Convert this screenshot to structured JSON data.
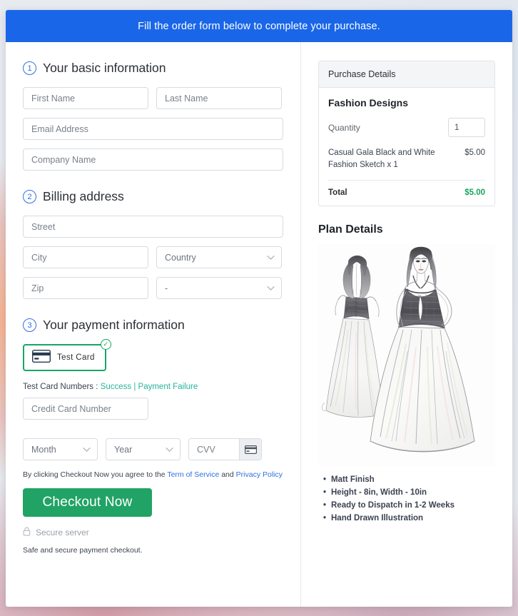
{
  "banner": {
    "message": "Fill the order form below to complete your purchase."
  },
  "colors": {
    "banner_blue": "#1a66e8",
    "accent_blue": "#2f6fe0",
    "success_green": "#16a765",
    "checkout_green": "#21a366",
    "total_green": "#17a45f",
    "link_teal": "#27b39a"
  },
  "steps": [
    {
      "number": "1",
      "title": "Your basic information"
    },
    {
      "number": "2",
      "title": "Billing address"
    },
    {
      "number": "3",
      "title": "Your payment information"
    }
  ],
  "basic_info": {
    "first_name_placeholder": "First Name",
    "last_name_placeholder": "Last Name",
    "email_placeholder": "Email Address",
    "company_placeholder": "Company Name",
    "first_name_value": "",
    "last_name_value": "",
    "email_value": "",
    "company_value": ""
  },
  "billing": {
    "street_placeholder": "Street",
    "city_placeholder": "City",
    "country_selected": "Country",
    "zip_placeholder": "Zip",
    "state_selected": "-",
    "street_value": "",
    "city_value": "",
    "zip_value": ""
  },
  "payment": {
    "method_label": "Test  Card",
    "method_selected": true,
    "test_cards_label": "Test Card Numbers :",
    "success_link": "Success",
    "separator": "|",
    "failure_link": "Payment Failure",
    "card_number_placeholder": "Credit Card Number",
    "card_number_value": "",
    "month_selected": "Month",
    "year_selected": "Year",
    "cvv_placeholder": "CVV",
    "cvv_value": ""
  },
  "terms": {
    "prefix": "By clicking Checkout Now you agree to the ",
    "tos_link": "Term of Service",
    "conjunction": " and ",
    "privacy_link": "Privacy Policy"
  },
  "actions": {
    "checkout_label": "Checkout Now",
    "secure_server_label": "Secure server",
    "safe_note": "Safe and secure payment checkout."
  },
  "purchase_details": {
    "panel_title": "Purchase Details",
    "product_title": "Fashion Designs",
    "quantity_label": "Quantity",
    "quantity_value": "1",
    "line_item_name": "Casual Gala Black and White Fashion Sketch x 1",
    "line_item_amount": "$5.00",
    "total_label": "Total",
    "total_amount": "$5.00"
  },
  "plan_details": {
    "title": "Plan Details",
    "image_alt": "fashion-sketch-two-models-ball-gowns",
    "features": [
      "Matt Finish",
      "Height - 8in, Width - 10in",
      "Ready to Dispatch in 1-2 Weeks",
      "Hand Drawn Illustration"
    ]
  }
}
